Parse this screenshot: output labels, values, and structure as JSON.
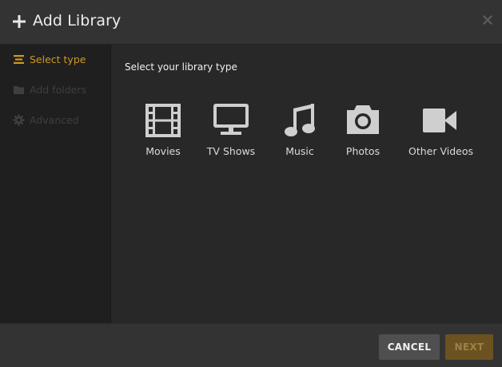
{
  "header": {
    "title": "Add Library",
    "plus_icon": "plus-icon",
    "close_icon": "close-icon"
  },
  "sidebar": {
    "items": [
      {
        "label": "Select type",
        "icon": "list-icon",
        "active": true
      },
      {
        "label": "Add folders",
        "icon": "folder-icon",
        "active": false
      },
      {
        "label": "Advanced",
        "icon": "gear-icon",
        "active": false
      }
    ]
  },
  "main": {
    "prompt": "Select your library type",
    "types": [
      {
        "label": "Movies",
        "icon": "film-icon"
      },
      {
        "label": "TV Shows",
        "icon": "tv-icon"
      },
      {
        "label": "Music",
        "icon": "music-note-icon"
      },
      {
        "label": "Photos",
        "icon": "camera-icon"
      },
      {
        "label": "Other Videos",
        "icon": "video-camera-icon"
      }
    ]
  },
  "footer": {
    "cancel_label": "CANCEL",
    "next_label": "NEXT"
  },
  "colors": {
    "accent": "#cc9a20",
    "header_bg": "#333333",
    "sidebar_bg": "#1f1f1f",
    "main_bg": "#282828",
    "icon_color": "#cfcfcf",
    "next_bg": "#6b5220"
  }
}
